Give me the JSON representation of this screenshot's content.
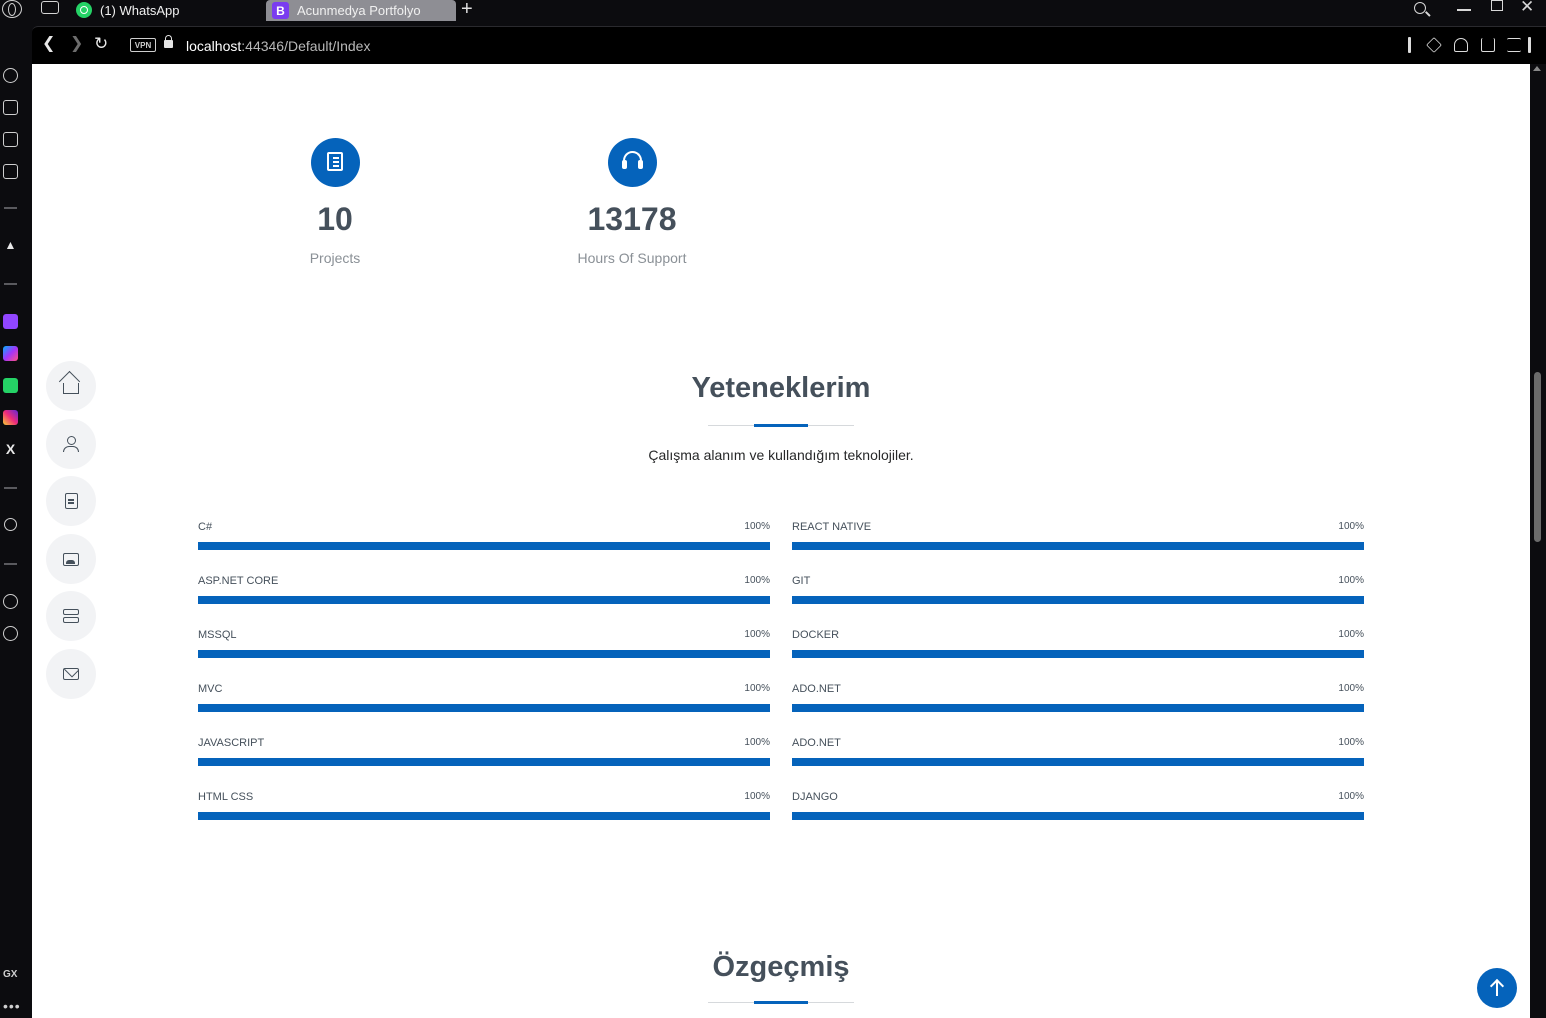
{
  "browser": {
    "tabs": [
      {
        "label": "(1) WhatsApp"
      },
      {
        "label": "Acunmedya Portfolyo",
        "icon_letter": "B"
      }
    ],
    "url_host": "localhost",
    "url_path": ":44346/Default/Index",
    "vpn_label": "VPN",
    "sidebar_gx": "GX",
    "sidebar_more": "•••"
  },
  "counters": [
    {
      "value": "10",
      "label": "Projects",
      "icon": "journal-icon"
    },
    {
      "value": "13178",
      "label": "Hours Of Support",
      "icon": "headset-icon"
    }
  ],
  "skills_section": {
    "title": "Yeteneklerim",
    "subtitle": "Çalışma alanım ve kullandığım teknolojiler.",
    "left": [
      {
        "name": "C#",
        "percent": "100%",
        "level": 100
      },
      {
        "name": "ASP.NET CORE",
        "percent": "100%",
        "level": 100
      },
      {
        "name": "MSSQL",
        "percent": "100%",
        "level": 100
      },
      {
        "name": "MVC",
        "percent": "100%",
        "level": 100
      },
      {
        "name": "JAVASCRIPT",
        "percent": "100%",
        "level": 100
      },
      {
        "name": "HTML CSS",
        "percent": "100%",
        "level": 100
      }
    ],
    "right": [
      {
        "name": "REACT NATIVE",
        "percent": "100%",
        "level": 100
      },
      {
        "name": "GIT",
        "percent": "100%",
        "level": 100
      },
      {
        "name": "DOCKER",
        "percent": "100%",
        "level": 100
      },
      {
        "name": "ADO.NET",
        "percent": "100%",
        "level": 100
      },
      {
        "name": "ADO.NET",
        "percent": "100%",
        "level": 100
      },
      {
        "name": "DJANGO",
        "percent": "100%",
        "level": 100
      }
    ]
  },
  "resume_section": {
    "title": "Özgeçmiş"
  },
  "colors": {
    "accent": "#0563bb",
    "heading": "#45505b",
    "muted": "#8a9096"
  }
}
